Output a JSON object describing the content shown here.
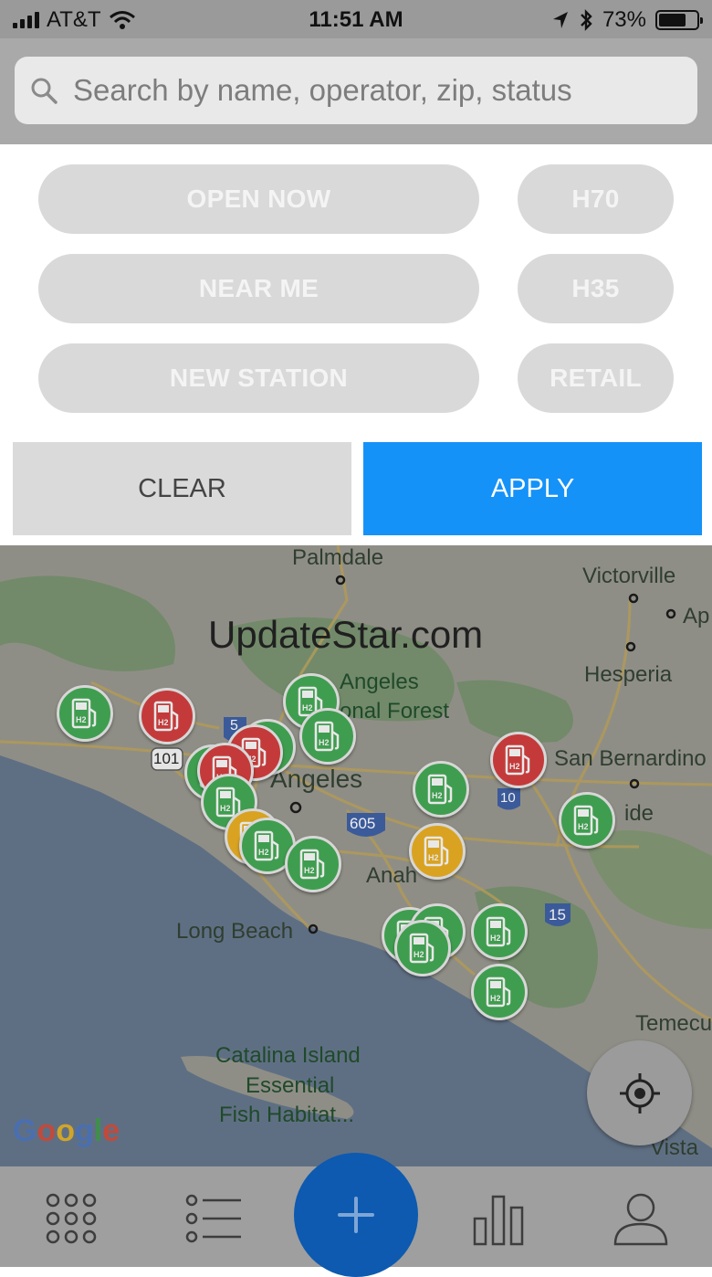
{
  "status_bar": {
    "carrier": "AT&T",
    "time": "11:51 AM",
    "battery_percent": "73%",
    "battery_level": 0.73
  },
  "search": {
    "placeholder": "Search by name, operator, zip, status"
  },
  "filters": {
    "chips": [
      {
        "label": "OPEN NOW"
      },
      {
        "label": "H70"
      },
      {
        "label": "NEAR ME"
      },
      {
        "label": "H35"
      },
      {
        "label": "NEW STATION"
      },
      {
        "label": "RETAIL"
      }
    ],
    "clear_label": "CLEAR",
    "apply_label": "APPLY"
  },
  "map": {
    "watermark": "UpdateStar.com",
    "labels": [
      "Palmdale",
      "Victorville",
      "Ap",
      "Angeles",
      "onal Forest",
      "Hesperia",
      "San Bernardino",
      "Angeles",
      "ide",
      "Anah",
      "Long Beach",
      "Temecu",
      "Catalina Island",
      "Essential",
      "Fish Habitat...",
      "Vista"
    ],
    "shields": [
      "101",
      "5",
      "605",
      "10",
      "15"
    ],
    "google_logo": "Google",
    "pin_label": "H2"
  },
  "colors": {
    "apply": "#1592f8",
    "fab": "#0d5ab0",
    "pin_green": "#3f9d4f",
    "pin_red": "#c43a3a",
    "pin_yellow": "#d9a321"
  },
  "icons": {
    "search": "search-icon",
    "locate": "crosshair-icon",
    "nav": [
      "grid-icon",
      "list-icon",
      "plus-icon",
      "bar-chart-icon",
      "user-icon"
    ]
  }
}
